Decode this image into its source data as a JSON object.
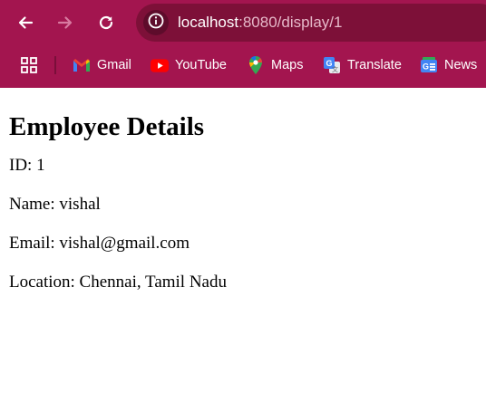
{
  "browser": {
    "url_host": "localhost",
    "url_rest": ":8080/display/1",
    "colors": {
      "toolbar": "#a3154f",
      "omnibox": "#7d1038"
    },
    "bookmarks": [
      {
        "label": "Gmail",
        "icon": "gmail-icon"
      },
      {
        "label": "YouTube",
        "icon": "youtube-icon"
      },
      {
        "label": "Maps",
        "icon": "maps-icon"
      },
      {
        "label": "Translate",
        "icon": "translate-icon"
      },
      {
        "label": "News",
        "icon": "news-icon"
      }
    ]
  },
  "page": {
    "heading": "Employee Details",
    "id_line": "ID: 1",
    "name_line": "Name: vishal",
    "email_line": "Email: vishal@gmail.com",
    "location_line": "Location: Chennai, Tamil Nadu"
  }
}
